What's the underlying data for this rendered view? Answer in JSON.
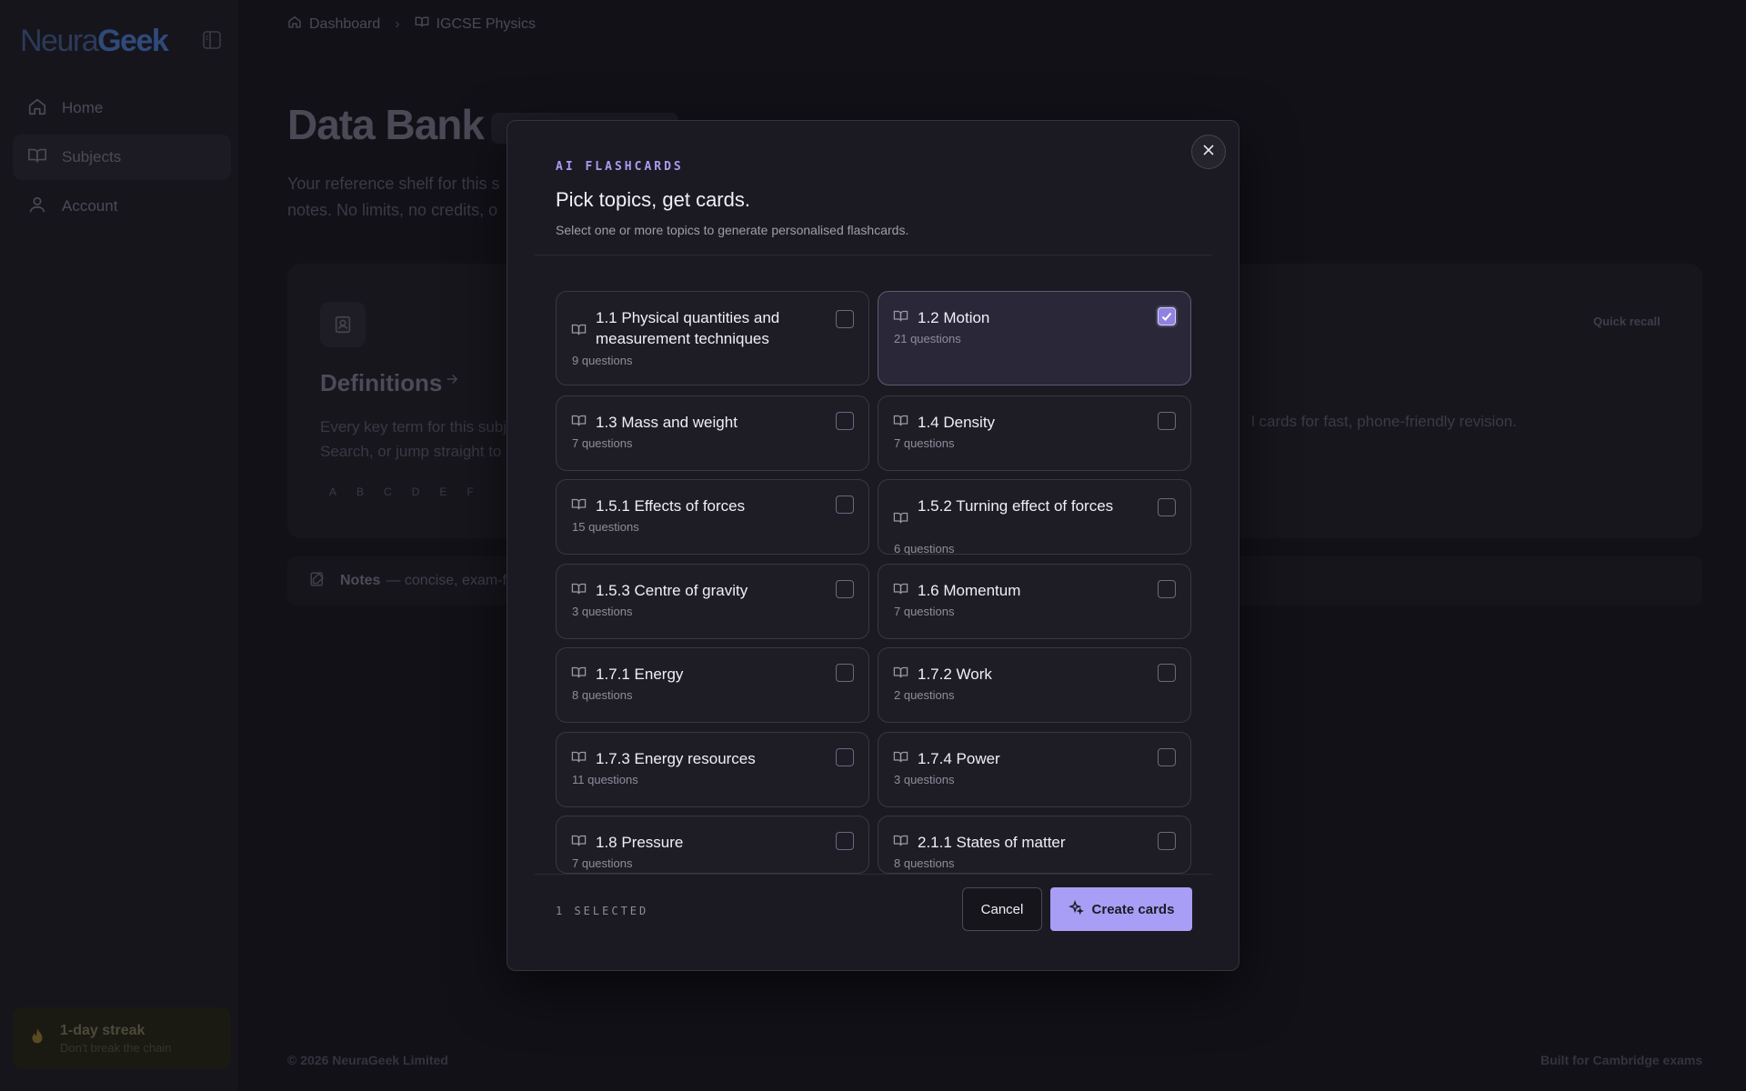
{
  "sidebar": {
    "logo_part1": "Neura",
    "logo_part2": "Geek",
    "items": [
      {
        "label": "Home",
        "icon": "home-icon"
      },
      {
        "label": "Subjects",
        "icon": "book-icon",
        "active": true
      },
      {
        "label": "Account",
        "icon": "user-icon"
      }
    ],
    "streak": {
      "title": "1-day streak",
      "subtitle": "Don't break the chain"
    }
  },
  "breadcrumb": {
    "items": [
      "Dashboard",
      "IGCSE Physics"
    ]
  },
  "page": {
    "title": "Data Bank",
    "description": "Your reference shelf for this s notes. No limits, no credits, o",
    "definitions": {
      "title": "Definitions",
      "text": "Every key term for this subj Search, or jump straight to",
      "alphabet": [
        "A",
        "B",
        "C",
        "D",
        "E",
        "F"
      ]
    },
    "quick_recall": {
      "label": "Quick recall",
      "text": "l cards for fast, phone-friendly revision."
    },
    "notes": {
      "label": "Notes",
      "text": "— concise, exam-fo"
    }
  },
  "footer": {
    "left": "© 2026 NeuraGeek Limited",
    "right": "Built for Cambridge exams"
  },
  "modal": {
    "eyebrow": "AI FLASHCARDS",
    "title": "Pick topics, get cards.",
    "subtitle": "Select one or more topics to generate personalised flashcards.",
    "topics": [
      {
        "name": "1.1 Physical quantities and measurement techniques",
        "count": "9 questions",
        "selected": false
      },
      {
        "name": "1.2 Motion",
        "count": "21 questions",
        "selected": true
      },
      {
        "name": "1.3 Mass and weight",
        "count": "7 questions",
        "selected": false
      },
      {
        "name": "1.4 Density",
        "count": "7 questions",
        "selected": false
      },
      {
        "name": "1.5.1 Effects of forces",
        "count": "15 questions",
        "selected": false
      },
      {
        "name": "1.5.2 Turning effect of forces",
        "count": "6 questions",
        "selected": false
      },
      {
        "name": "1.5.3 Centre of gravity",
        "count": "3 questions",
        "selected": false
      },
      {
        "name": "1.6 Momentum",
        "count": "7 questions",
        "selected": false
      },
      {
        "name": "1.7.1 Energy",
        "count": "8 questions",
        "selected": false
      },
      {
        "name": "1.7.2 Work",
        "count": "2 questions",
        "selected": false
      },
      {
        "name": "1.7.3 Energy resources",
        "count": "11 questions",
        "selected": false
      },
      {
        "name": "1.7.4 Power",
        "count": "3 questions",
        "selected": false
      },
      {
        "name": "1.8 Pressure",
        "count": "7 questions",
        "selected": false
      },
      {
        "name": "2.1.1 States of matter",
        "count": "8 questions",
        "selected": false
      }
    ],
    "selected_count": "1 SELECTED",
    "cancel_label": "Cancel",
    "create_label": "Create cards"
  },
  "colors": {
    "accent": "#a99ef5",
    "eyebrow": "#a89cf0",
    "modal_bg": "#1b1a23"
  }
}
